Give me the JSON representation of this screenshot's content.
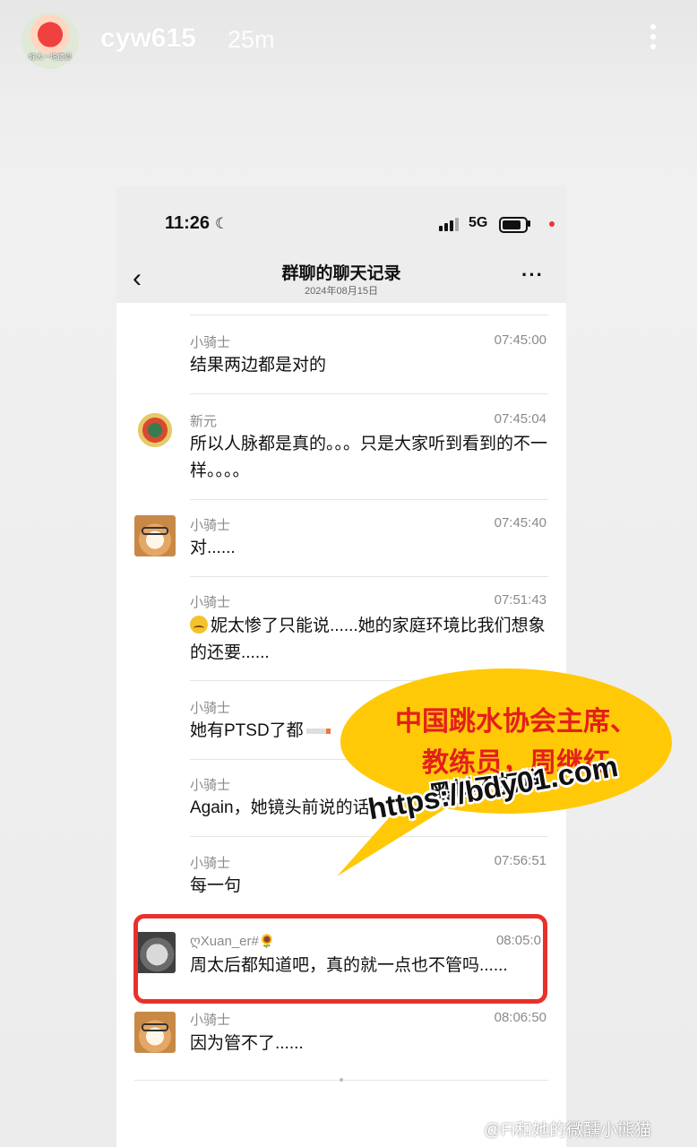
{
  "story": {
    "username": "cyw615",
    "elapsed": "25m",
    "avatar_caption": "好大一坨傻逼"
  },
  "status_bar": {
    "time": "11:26",
    "moon_glyph": "☾",
    "network": "5G"
  },
  "chat": {
    "title": "群聊的聊天记录",
    "date": "2024年08月15日",
    "back_glyph": "‹",
    "more_glyph": "···",
    "messages": [
      {
        "sender": "小骑士",
        "time": "07:45:00",
        "text": "结果两边都是对的",
        "avatar": "none"
      },
      {
        "sender": "新元",
        "time": "07:45:04",
        "text": "所以人脉都是真的。。。只是大家听到看到的不一样。。。。",
        "avatar": "dragon-avatar"
      },
      {
        "sender": "小骑士",
        "time": "07:45:40",
        "text": "对......",
        "avatar": "dog-avatar"
      },
      {
        "sender": "小骑士",
        "time": "07:51:43",
        "text": "妮太惨了只能说......她的家庭环境比我们想象的还要......",
        "avatar": "none"
      },
      {
        "sender": "小骑士",
        "time": "",
        "text": "她有PTSD了都",
        "avatar": "none"
      },
      {
        "sender": "小骑士",
        "time": "",
        "text": "Again，她镜头前说的话",
        "avatar": "none"
      },
      {
        "sender": "小骑士",
        "time": "07:56:51",
        "text": "每一句",
        "avatar": "none"
      },
      {
        "sender": "ღXuan_er#🌻",
        "time": "08:05:0",
        "text": "周太后都知道吧，真的就一点也不管吗......",
        "avatar": "cat-avatar"
      },
      {
        "sender": "小骑士",
        "time": "08:06:50",
        "text": "因为管不了......",
        "avatar": "dog-avatar"
      }
    ]
  },
  "overlay": {
    "bubble_line1": "中国跳水协会主席、",
    "bubble_line2": "教练员，周继红",
    "watermark_cn": "黑料不打烊",
    "watermark_url": "https://bdy01.com"
  },
  "footer": {
    "weibo_watermark": "@Fi和她的微醺小熊猫"
  },
  "colors": {
    "highlight_border": "#e8312a",
    "bubble_fill": "#ffc907",
    "bubble_text": "#e3201b"
  }
}
